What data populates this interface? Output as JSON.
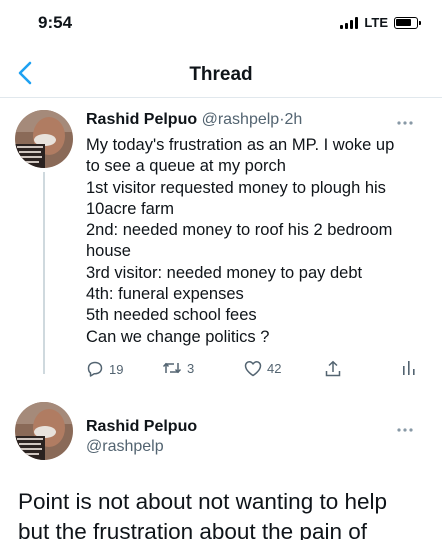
{
  "status": {
    "time": "9:54",
    "network": "LTE"
  },
  "nav": {
    "title": "Thread"
  },
  "tweet1": {
    "name": "Rashid Pelpuo",
    "handle": "@rashpelp",
    "separator": "·",
    "time": "2h",
    "lines": [
      "My today's frustration as an MP. I woke up",
      "to see a queue at my porch",
      "1st visitor requested money to plough his",
      "10acre farm",
      "2nd: needed money to roof his 2 bedroom",
      "house",
      "3rd visitor: needed money to pay debt",
      "4th: funeral expenses",
      "5th needed school fees",
      "Can we change politics ?"
    ],
    "replies": "19",
    "retweets": "3",
    "likes": "42"
  },
  "tweet2": {
    "name": "Rashid Pelpuo",
    "handle": "@rashpelp",
    "lines": [
      "Point is not about not wanting to help",
      "but the frustration about the pain of"
    ]
  },
  "colors": {
    "accent": "#1da1f2",
    "secondary_text": "#536471",
    "divider": "#e1e8ed"
  },
  "icons": [
    "chevron-left-icon",
    "more-icon",
    "reply-icon",
    "retweet-icon",
    "like-icon",
    "share-icon",
    "analytics-icon"
  ]
}
